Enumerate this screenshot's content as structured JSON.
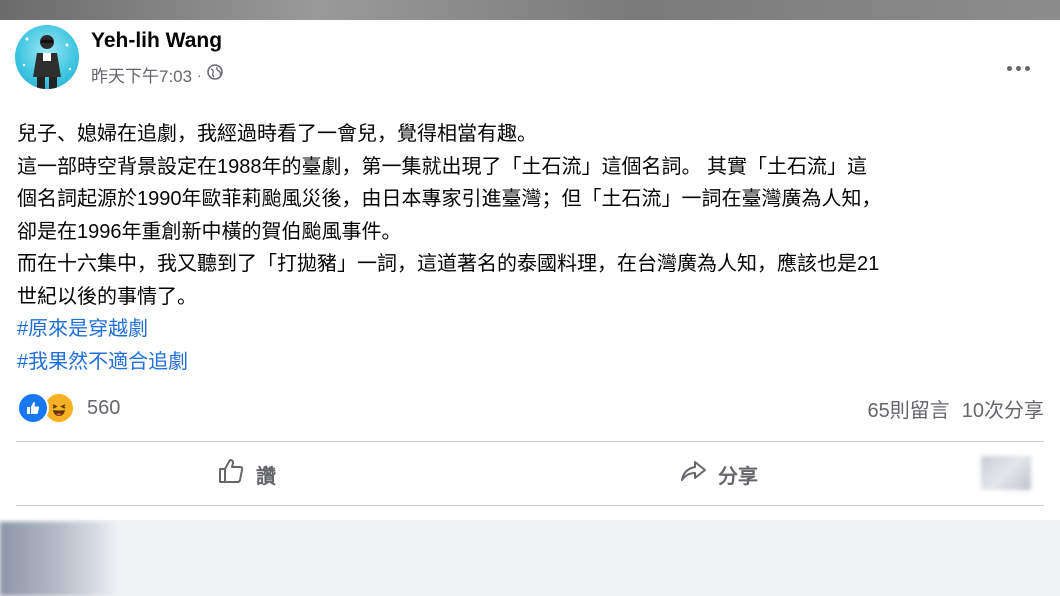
{
  "post": {
    "author": "Yeh-lih Wang",
    "timestamp": "昨天下午7:03",
    "separator": "·",
    "body_lines": [
      "兒子、媳婦在追劇，我經過時看了一會兒，覺得相當有趣。",
      "這一部時空背景設定在1988年的臺劇，第一集就出現了「土石流」這個名詞。 其實「土石流」這",
      "個名詞起源於1990年歐菲莉颱風災後，由日本專家引進臺灣；但「土石流」一詞在臺灣廣為人知，",
      "卻是在1996年重創新中橫的賀伯颱風事件。",
      "而在十六集中，我又聽到了「打拋豬」一詞，這道著名的泰國料理，在台灣廣為人知，應該也是21",
      "世紀以後的事情了。"
    ],
    "hashtags": [
      "#原來是穿越劇",
      "#我果然不適合追劇"
    ]
  },
  "engagement": {
    "reaction_count": "560",
    "comments": "65則留言",
    "shares": "10次分享"
  },
  "actions": {
    "like_label": "讚",
    "share_label": "分享"
  },
  "icons": {
    "privacy": "globe-icon",
    "more": "more-options-icon",
    "like_reaction": "like-reaction-icon",
    "haha_reaction": "haha-reaction-icon",
    "like_action": "thumbs-up-icon",
    "share_action": "share-arrow-icon"
  },
  "colors": {
    "hashtag": "#216fdb",
    "like_blue": "#1877f2",
    "haha_yellow": "#f7b125",
    "secondary_text": "#65676b"
  }
}
